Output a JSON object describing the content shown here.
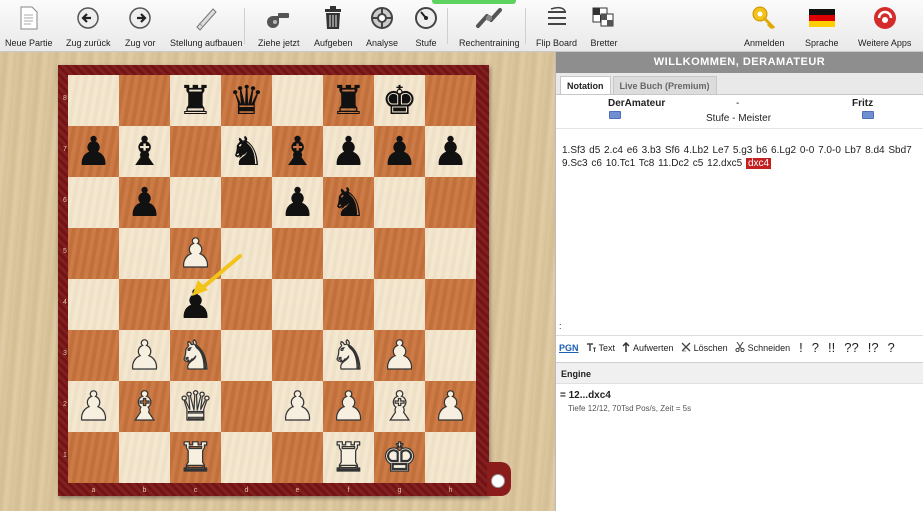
{
  "toolbar": {
    "items": [
      {
        "label": "Neue Partie",
        "icon": "new-document-icon"
      },
      {
        "label": "Zug zurück",
        "icon": "arrow-left-icon"
      },
      {
        "label": "Zug vor",
        "icon": "arrow-right-icon"
      },
      {
        "label": "Stellung aufbauen",
        "icon": "position-setup-icon"
      },
      {
        "label": "Ziehe jetzt",
        "icon": "whistle-icon"
      },
      {
        "label": "Aufgeben",
        "icon": "trash-icon"
      },
      {
        "label": "Analyse",
        "icon": "analysis-icon"
      },
      {
        "label": "Stufe",
        "icon": "gauge-icon"
      },
      {
        "label": "Rechentraining",
        "icon": "training-icon"
      },
      {
        "label": "Flip Board",
        "icon": "flip-board-icon"
      },
      {
        "label": "Bretter",
        "icon": "boards-icon"
      },
      {
        "label": "Anmelden",
        "icon": "key-icon"
      },
      {
        "label": "Sprache",
        "icon": "german-flag-icon"
      },
      {
        "label": "Weitere Apps",
        "icon": "apps-icon"
      }
    ]
  },
  "panel": {
    "welcome": "WILLKOMMEN, DERAMATEUR",
    "tabs": [
      "Notation",
      "Live Buch (Premium)"
    ],
    "white_player": "DerAmateur",
    "dash": "-",
    "black_player": "Fritz",
    "level": "Stufe - Meister",
    "flag_white": "W",
    "flag_black": "W",
    "moves": "1.Sf3 d5 2.c4 e6 3.b3 Sf6 4.Lb2 Le7 5.g3 b6 6.Lg2 0-0 7.0-0 Lb7 8.d4 Sbd7 9.Sc3 c6 10.Tc1 Tc8 11.Dc2 c5 12.dxc5",
    "current_move": "dxc4",
    "colon": ":",
    "notation_tools": {
      "pgn": "PGN",
      "text": "Text",
      "aufwerten": "Aufwerten",
      "loeschen": "Löschen",
      "schneiden": "Schneiden",
      "symbols": [
        "!",
        "?",
        "!!",
        "??",
        "!?",
        "?"
      ]
    },
    "engine_title": "Engine",
    "engine_line": "= 12...dxc4",
    "engine_info": "Tiefe 12/12, 70Tsd Pos/s, Zeit = 5s"
  },
  "board": {
    "files": [
      "a",
      "b",
      "c",
      "d",
      "e",
      "f",
      "g",
      "h"
    ],
    "ranks": [
      "8",
      "7",
      "6",
      "5",
      "4",
      "3",
      "2",
      "1"
    ],
    "position": [
      [
        "",
        "",
        "r",
        "q",
        "",
        "r",
        "k",
        ""
      ],
      [
        "p",
        "b",
        "",
        "n",
        "b",
        "p",
        "p",
        "p"
      ],
      [
        "",
        "p",
        "",
        "",
        "p",
        "n",
        "",
        ""
      ],
      [
        "",
        "",
        "P",
        "",
        "",
        "",
        "",
        ""
      ],
      [
        "",
        "",
        "p",
        "",
        "",
        "",
        "",
        ""
      ],
      [
        "",
        "P",
        "N",
        "",
        "",
        "N",
        "P",
        ""
      ],
      [
        "P",
        "B",
        "Q",
        "",
        "P",
        "P",
        "B",
        "P"
      ],
      [
        "",
        "",
        "R",
        "",
        "",
        "R",
        "K",
        ""
      ]
    ],
    "last_move_arrow_color": "#f2c318",
    "light_square_color": "#f4e6cd",
    "dark_square_color": "#c9743d"
  }
}
